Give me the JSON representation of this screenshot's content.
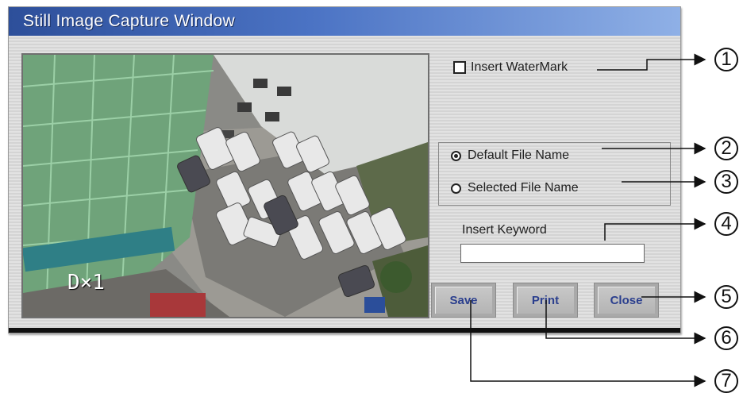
{
  "window": {
    "title": "Still Image Capture Window"
  },
  "preview": {
    "overlay_text": "D×1"
  },
  "options": {
    "watermark_label": "Insert WaterMark",
    "watermark_checked": false,
    "default_name_label": "Default File Name",
    "selected_name_label": "Selected File Name",
    "selected_option": "Default File Name"
  },
  "keyword": {
    "label": "Insert Keyword",
    "value": ""
  },
  "buttons": {
    "save": "Save",
    "print": "Print",
    "close": "Close"
  },
  "callouts": [
    "1",
    "2",
    "3",
    "4",
    "5",
    "6",
    "7"
  ]
}
